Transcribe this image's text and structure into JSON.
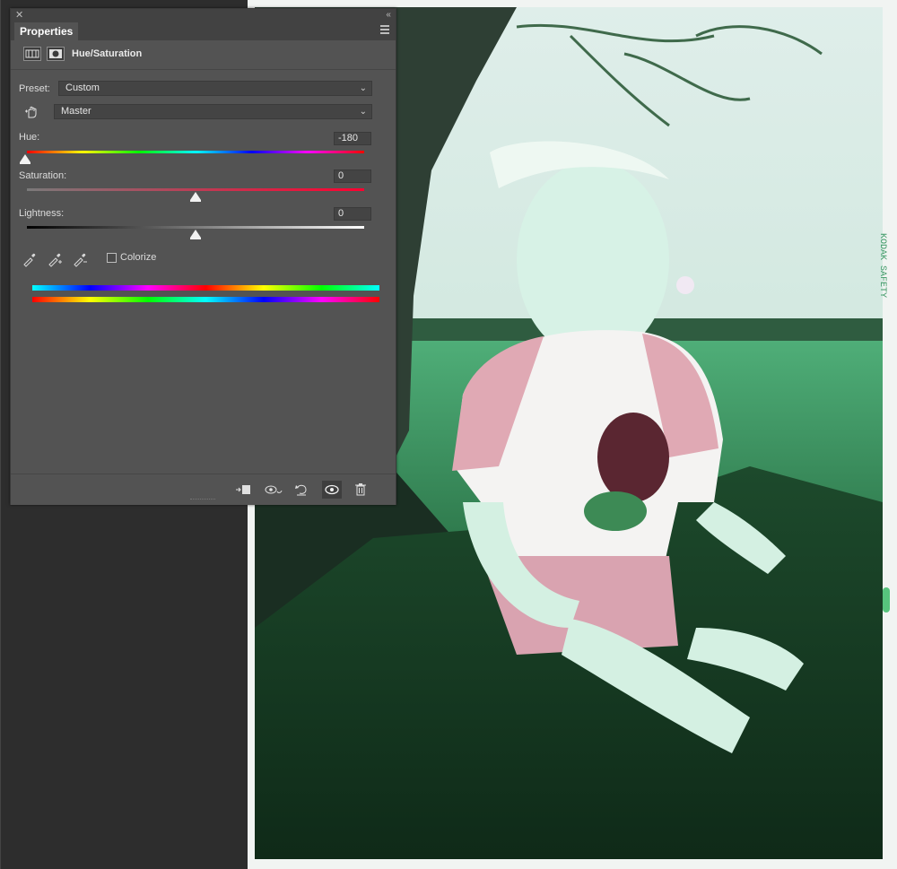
{
  "panel": {
    "tab_title": "Properties",
    "adjustment_title": "Hue/Saturation",
    "icons": {
      "close": "close-icon",
      "collapse": "collapse-icon",
      "menu": "panel-menu-icon",
      "adjustment": "hue-saturation-layer-icon",
      "mask": "layer-mask-icon"
    }
  },
  "preset": {
    "label": "Preset:",
    "value": "Custom"
  },
  "channel": {
    "value": "Master"
  },
  "sliders": {
    "hue": {
      "label": "Hue:",
      "value": "-180",
      "level": 0.0
    },
    "saturation": {
      "label": "Saturation:",
      "value": "0",
      "level": 0.5
    },
    "lightness": {
      "label": "Lightness:",
      "value": "0",
      "level": 0.5
    }
  },
  "colorize": {
    "label": "Colorize",
    "checked": false
  },
  "footer": {
    "buttons": [
      {
        "name": "clip-to-layer-button",
        "icon": "clip-to-layer-icon"
      },
      {
        "name": "view-previous-state-button",
        "icon": "view-previous-icon"
      },
      {
        "name": "reset-button",
        "icon": "reset-icon"
      },
      {
        "name": "toggle-visibility-button",
        "icon": "eye-icon"
      },
      {
        "name": "delete-button",
        "icon": "trash-icon"
      }
    ]
  },
  "colors": {
    "panel_bg": "#535353",
    "panel_header": "#424242",
    "field_bg": "#444444",
    "text": "#dcdcdc",
    "photo_tint": "#3f7a4f"
  }
}
